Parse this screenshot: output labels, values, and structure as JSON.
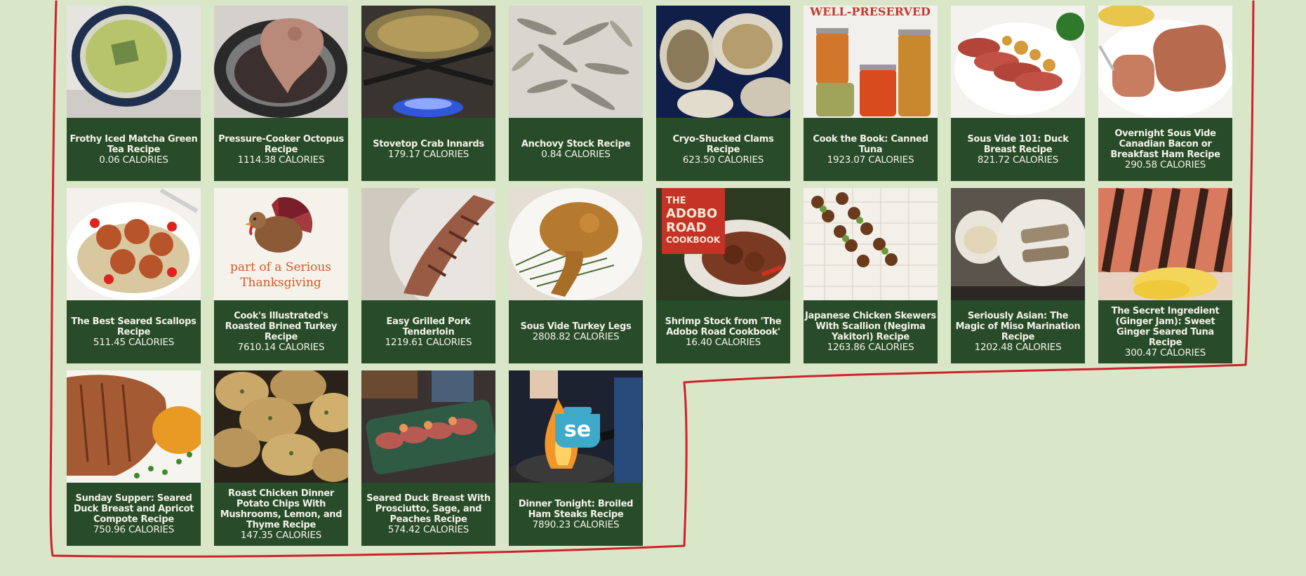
{
  "recipes": [
    {
      "title": "Frothy Iced Matcha Green Tea Recipe",
      "calories": "0.06 CALORIES",
      "photo": "matcha-bowl"
    },
    {
      "title": "Pressure-Cooker Octopus Recipe",
      "calories": "1114.38 CALORIES",
      "photo": "octopus-pot"
    },
    {
      "title": "Stovetop Crab Innards",
      "calories": "179.17 CALORIES",
      "photo": "crab-shell-flame"
    },
    {
      "title": "Anchovy Stock Recipe",
      "calories": "0.84 CALORIES",
      "photo": "dried-anchovies"
    },
    {
      "title": "Cryo-Shucked Clams Recipe",
      "calories": "623.50 CALORIES",
      "photo": "clams"
    },
    {
      "title": "Cook the Book: Canned Tuna",
      "calories": "1923.07 CALORIES",
      "photo": "preserve-jars",
      "photo_text": "WELL-PRESERVED"
    },
    {
      "title": "Sous Vide 101: Duck Breast Recipe",
      "calories": "821.72 CALORIES",
      "photo": "sliced-duck"
    },
    {
      "title": "Overnight Sous Vide Canadian Bacon or Breakfast Ham Recipe",
      "calories": "290.58 CALORIES",
      "photo": "ham-plate"
    },
    {
      "title": "The Best Seared Scallops Recipe",
      "calories": "511.45 CALORIES",
      "photo": "scallops"
    },
    {
      "title": "Cook's Illustrated's Roasted Brined Turkey Recipe",
      "calories": "7610.14 CALORIES",
      "photo": "turkey-graphic",
      "photo_text": "part of a Serious Thanksgiving"
    },
    {
      "title": "Easy Grilled Pork Tenderloin",
      "calories": "1219.61 CALORIES",
      "photo": "pork-tenderloin"
    },
    {
      "title": "Sous Vide Turkey Legs",
      "calories": "2808.82 CALORIES",
      "photo": "turkey-leg"
    },
    {
      "title": "Shrimp Stock from 'The Adobo Road Cookbook'",
      "calories": "16.40 CALORIES",
      "photo": "adobo-book",
      "photo_text": "THE ADOBO ROAD COOKBOOK"
    },
    {
      "title": "Japanese Chicken Skewers With Scallion (Negima Yakitori) Recipe",
      "calories": "1263.86 CALORIES",
      "photo": "skewers"
    },
    {
      "title": "Seriously Asian: The Magic of Miso Marination Recipe",
      "calories": "1202.48 CALORIES",
      "photo": "miso-fish"
    },
    {
      "title": "The Secret Ingredient (Ginger Jam): Sweet Ginger Seared Tuna Recipe",
      "calories": "300.47 CALORIES",
      "photo": "seared-tuna"
    },
    {
      "title": "Sunday Supper: Seared Duck Breast and Apricot Compote Recipe",
      "calories": "750.96 CALORIES",
      "photo": "duck-apricot"
    },
    {
      "title": "Roast Chicken Dinner Potato Chips With Mushrooms, Lemon, and Thyme Recipe",
      "calories": "147.35 CALORIES",
      "photo": "potato-chips"
    },
    {
      "title": "Seared Duck Breast With Prosciutto, Sage, and Peaches Recipe",
      "calories": "574.42 CALORIES",
      "photo": "duck-platter"
    },
    {
      "title": "Dinner Tonight: Broiled Ham Steaks Recipe",
      "calories": "7890.23 CALORIES",
      "photo": "se-logo-wok",
      "photo_text": "se"
    }
  ],
  "annotation": {
    "color": "#d0202c"
  }
}
